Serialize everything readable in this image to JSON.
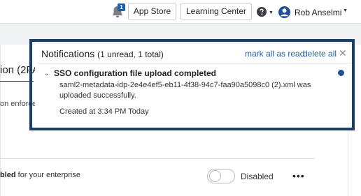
{
  "header": {
    "notification_badge": "1",
    "app_store_label": "App Store",
    "learning_center_label": "Learning Center",
    "user_name": "Rob Anselmi"
  },
  "background": {
    "title_fragment": "ion (2FA",
    "subtitle_fragment": "on enforce",
    "enterprise_bold": "bled",
    "enterprise_rest": " for your enterprise",
    "toggle_label": "Disabled",
    "more_label": "•••"
  },
  "notifications": {
    "title": "Notifications",
    "count_text": "(1 unread, 1 total)",
    "mark_all_label": "mark all as read",
    "delete_all_label": "delete all",
    "close_label": "✕",
    "items": [
      {
        "title": "SSO configuration file upload completed",
        "body": "saml2-metadata-idp-2e4e4ef5-eb11-4f38-94c7-faa90a5098c0 (2).xml was uploaded successfully.",
        "created": "Created at 3:34 PM Today",
        "unread": true
      }
    ]
  },
  "colors": {
    "accent": "#1f5fa8",
    "highlight_frame": "#1b3f66",
    "unread_dot": "#1f4e9a"
  }
}
